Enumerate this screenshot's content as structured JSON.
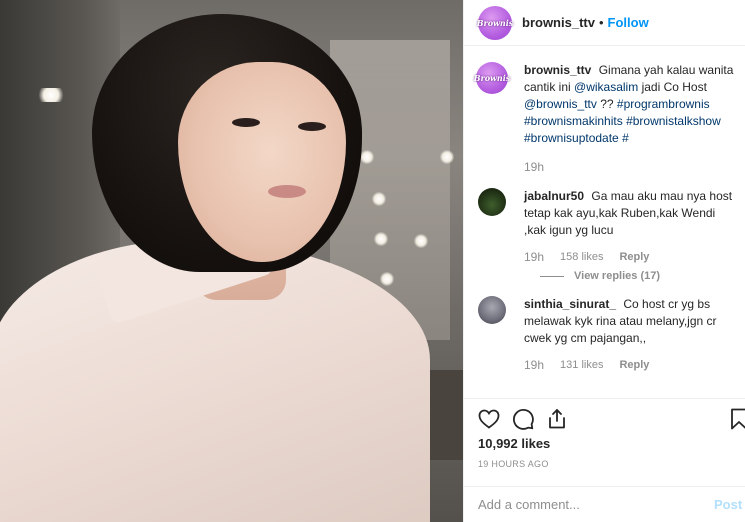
{
  "header": {
    "avatar_text": "Brownis",
    "username": "brownis_ttv",
    "separator": "•",
    "follow_label": "Follow"
  },
  "caption": {
    "avatar_text": "Brownis",
    "username": "brownis_ttv",
    "text_before_mention": "Gimana yah kalau wanita cantik ini",
    "mention_1": "@wikasalim",
    "text_middle": "jadi Co Host",
    "mention_2": "@brownis_ttv",
    "text_after": "??",
    "hashtags": [
      "#programbrownis",
      "#brownismakinhits",
      "#brownistalkshow",
      "#brownisuptodate",
      "#"
    ],
    "time": "19h"
  },
  "comments": [
    {
      "username": "jabalnur50",
      "text": "Ga mau aku mau nya host tetap kak ayu,kak Ruben,kak Wendi ,kak igun yg lucu",
      "time": "19h",
      "likes": "158 likes",
      "reply_label": "Reply",
      "view_replies": "View replies (17)"
    },
    {
      "username": "sinthia_sinurat_",
      "text": "Co host cr yg bs melawak kyk rina atau melany,jgn cr cwek yg cm pajangan,,",
      "time": "19h",
      "likes": "131 likes",
      "reply_label": "Reply"
    }
  ],
  "actions": {
    "like_icon": "heart-icon",
    "comment_icon": "comment-icon",
    "share_icon": "share-icon",
    "save_icon": "bookmark-icon"
  },
  "likes_count": "10,992 likes",
  "post_time": "19 HOURS AGO",
  "add_comment": {
    "placeholder": "Add a comment...",
    "post_label": "Post"
  },
  "colors": {
    "link": "#0095f6",
    "mention": "#00376b",
    "muted": "#8e8e8e",
    "text": "#262626",
    "avatar_purple": "#b45ee0"
  }
}
